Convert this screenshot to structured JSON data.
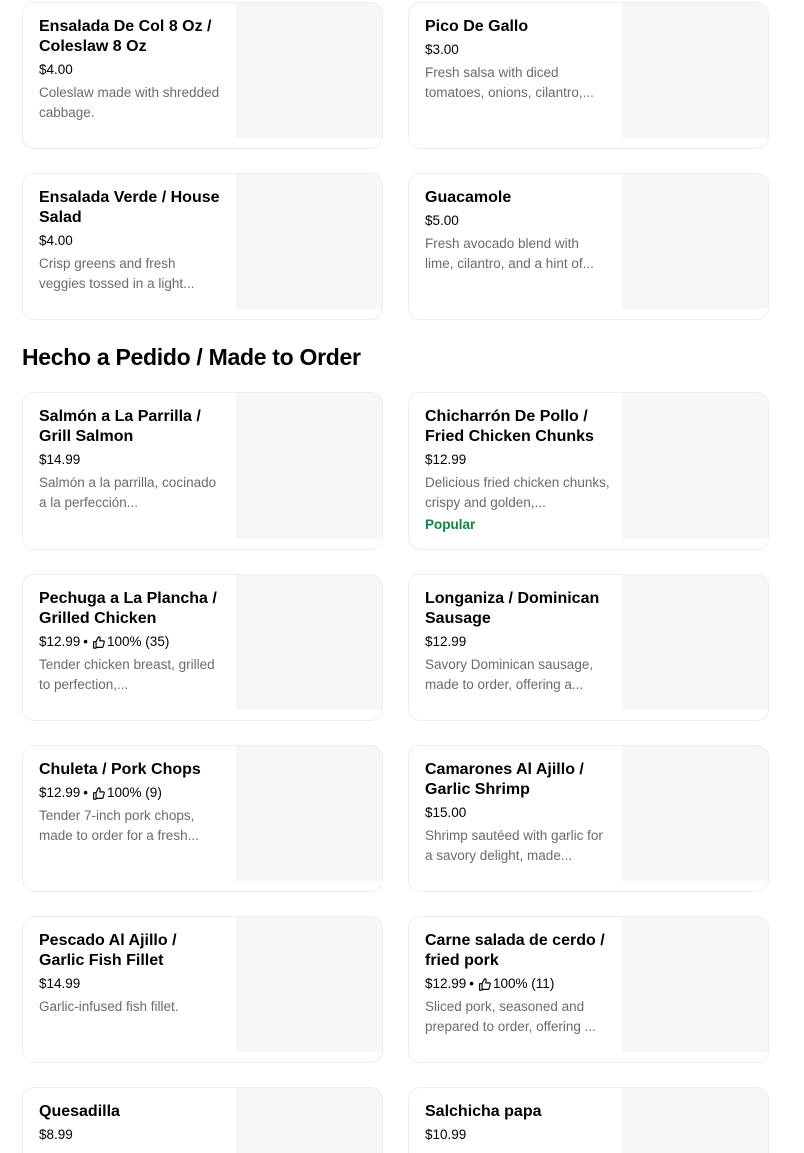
{
  "sections": [
    {
      "title": "",
      "items": [
        {
          "name": "Ensalada De Col 8 Oz / Coleslaw 8 Oz",
          "price": "$4.00",
          "description": "Coleslaw made with shredded cabbage."
        },
        {
          "name": "Pico De Gallo",
          "price": "$3.00",
          "description": "Fresh salsa with diced tomatoes, onions, cilantro,..."
        },
        {
          "name": "Ensalada Verde / House Salad",
          "price": "$4.00",
          "description": "Crisp greens and fresh veggies tossed in a light..."
        },
        {
          "name": "Guacamole",
          "price": "$5.00",
          "description": "Fresh avocado blend with lime, cilantro, and a hint of..."
        }
      ]
    },
    {
      "title": "Hecho a Pedido / Made to Order",
      "items": [
        {
          "name": "Salmón a La Parrilla / Grill Salmon",
          "price": "$14.99",
          "description": "Salmón a la parrilla, cocinado a la perfección..."
        },
        {
          "name": "Chicharrón De Pollo / Fried Chicken Chunks",
          "price": "$12.99",
          "description": "Delicious fried chicken chunks, crispy and golden,...",
          "badge": "Popular"
        },
        {
          "name": "Pechuga a La Plancha / Grilled Chicken",
          "price": "$12.99",
          "rating": "100% (35)",
          "description": "Tender chicken breast, grilled to perfection,..."
        },
        {
          "name": "Longaniza / Dominican Sausage",
          "price": "$12.99",
          "description": "Savory Dominican sausage, made to order, offering a..."
        },
        {
          "name": "Chuleta / Pork Chops",
          "price": "$12.99",
          "rating": "100% (9)",
          "description": "Tender 7-inch pork chops, made to order for a fresh..."
        },
        {
          "name": "Camarones Al Ajillo / Garlic Shrimp",
          "price": "$15.00",
          "description": "Shrimp sautéed with garlic for a savory delight, made..."
        },
        {
          "name": "Pescado Al Ajillo / Garlic Fish Fillet",
          "price": "$14.99",
          "description": "Garlic-infused fish fillet."
        },
        {
          "name": "Carne salada de cerdo / fried pork",
          "price": "$12.99",
          "rating": "100% (11)",
          "description": "Sliced pork, seasoned and prepared to order, offering ..."
        },
        {
          "name": "Quesadilla",
          "price": "$8.99",
          "description": ""
        },
        {
          "name": "Salchicha papa",
          "price": "$10.99",
          "description": ""
        }
      ]
    }
  ],
  "icons": {
    "rating": "thumbs-up-icon"
  },
  "colors": {
    "popular_badge": "#0e8345",
    "thumbnail_placeholder": "#f6f6f6",
    "description_text": "#6b6b6b"
  }
}
